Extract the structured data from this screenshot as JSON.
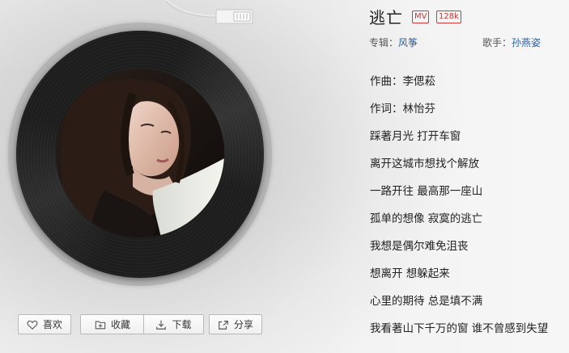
{
  "song": {
    "title": "逃亡",
    "badges": {
      "mv": "MV",
      "quality": "128k"
    },
    "album_label": "专辑：",
    "album": "风筝",
    "singer_label": "歌手：",
    "singer": "孙燕姿"
  },
  "lyrics": [
    "作曲：李偲菘",
    "作词：林怡芬",
    "踩著月光 打开车窗",
    "离开这城市想找个解放",
    "一路开往 最高那一座山",
    "孤单的想像 寂寞的逃亡",
    "我想是偶尔难免沮丧",
    "想离开 想躲起来",
    "心里的期待 总是填不满",
    "我看著山下千万的窗 谁不曾感到失望"
  ],
  "actions": {
    "like": "喜欢",
    "collect": "收藏",
    "download": "下载",
    "share": "分享"
  },
  "colors": {
    "badge": "#d03838",
    "link": "#2b5fa8"
  }
}
